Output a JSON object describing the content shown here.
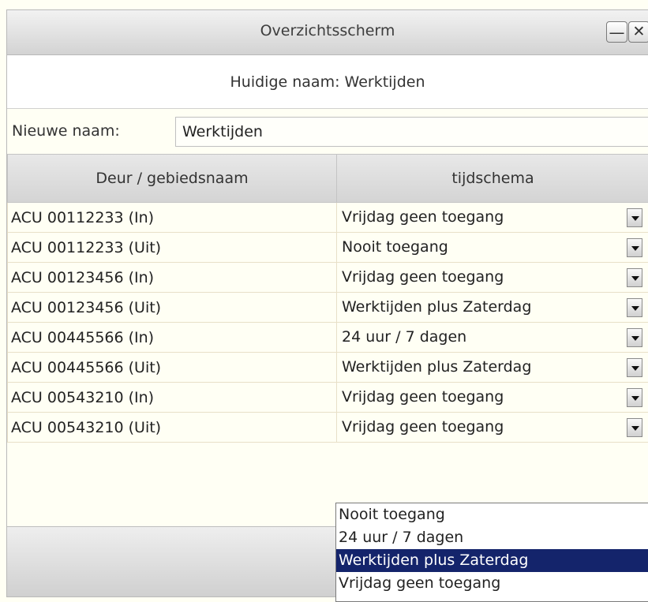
{
  "window": {
    "title": "Overzichtsscherm"
  },
  "current_name": "Huidige naam: Werktijden",
  "rename": {
    "label": "Nieuwe naam:",
    "value": "Werktijden"
  },
  "table": {
    "headers": [
      "Deur / gebiedsnaam",
      "tijdschema"
    ],
    "rows": [
      {
        "door": "ACU 00112233 (In)",
        "schedule": "Vrijdag geen toegang"
      },
      {
        "door": "ACU 00112233 (Uit)",
        "schedule": "Nooit toegang"
      },
      {
        "door": "ACU 00123456 (In)",
        "schedule": "Vrijdag geen toegang"
      },
      {
        "door": "ACU 00123456 (Uit)",
        "schedule": "Werktijden plus Zaterdag"
      },
      {
        "door": "ACU 00445566 (In)",
        "schedule": "24 uur / 7 dagen"
      },
      {
        "door": "ACU 00445566 (Uit)",
        "schedule": "Werktijden plus Zaterdag"
      },
      {
        "door": "ACU 00543210 (In)",
        "schedule": "Vrijdag geen toegang"
      },
      {
        "door": "ACU 00543210 (Uit)",
        "schedule": "Vrijdag geen toegang"
      }
    ]
  },
  "dropdown": {
    "options": [
      "Nooit toegang",
      "24 uur / 7 dagen",
      "Werktijden plus Zaterdag",
      "Vrijdag geen toegang"
    ],
    "highlighted": "Werktijden plus Zaterdag"
  },
  "icons": {
    "minimize": "minimize-icon",
    "close": "close-icon",
    "dropdown": "chevron-down-icon"
  },
  "colors": {
    "highlight": "#14246b",
    "background": "#fffff4"
  }
}
